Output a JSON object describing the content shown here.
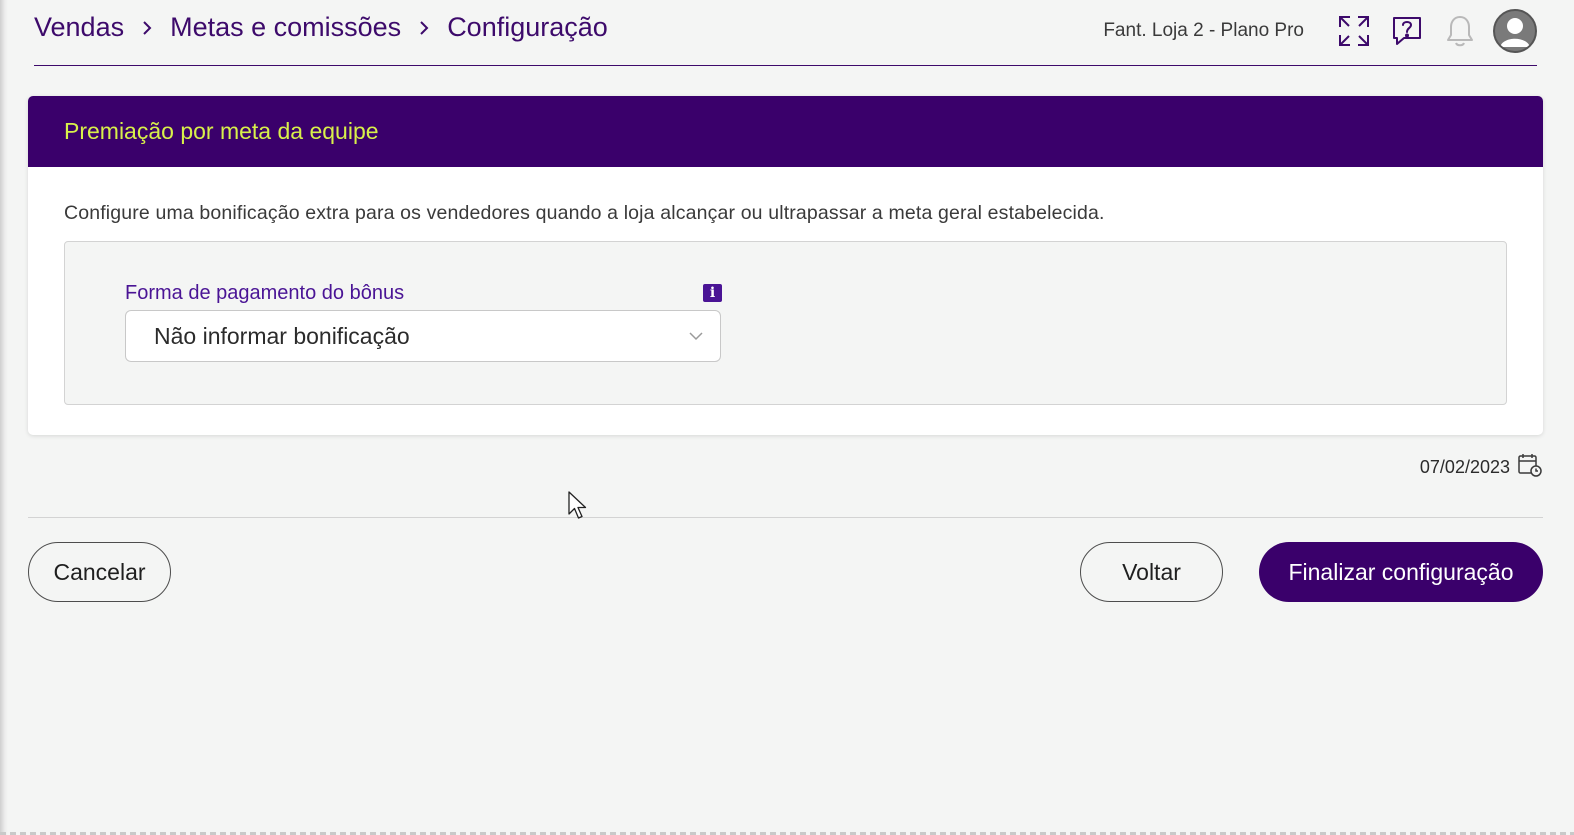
{
  "breadcrumb": [
    "Vendas",
    "Metas e comissões",
    "Configuração"
  ],
  "header": {
    "store_label": "Fant. Loja 2 - Plano Pro",
    "icons": [
      "expand-icon",
      "help-chat-icon",
      "bell-icon",
      "user-avatar-icon"
    ]
  },
  "card": {
    "title": "Premiação por meta da equipe",
    "description": "Configure uma bonificação extra para os vendedores quando a loja alcançar ou ultrapassar a meta geral estabelecida.",
    "field": {
      "label": "Forma de pagamento do bônus",
      "info_icon": "i",
      "selected": "Não informar bonificação"
    }
  },
  "date": "07/02/2023",
  "buttons": {
    "cancel": "Cancelar",
    "back": "Voltar",
    "finish": "Finalizar configuração"
  },
  "colors": {
    "brand_purple": "#3a006b",
    "accent_yellow": "#d8f04a",
    "label_purple": "#4a1495",
    "background": "#f4f5f4"
  }
}
